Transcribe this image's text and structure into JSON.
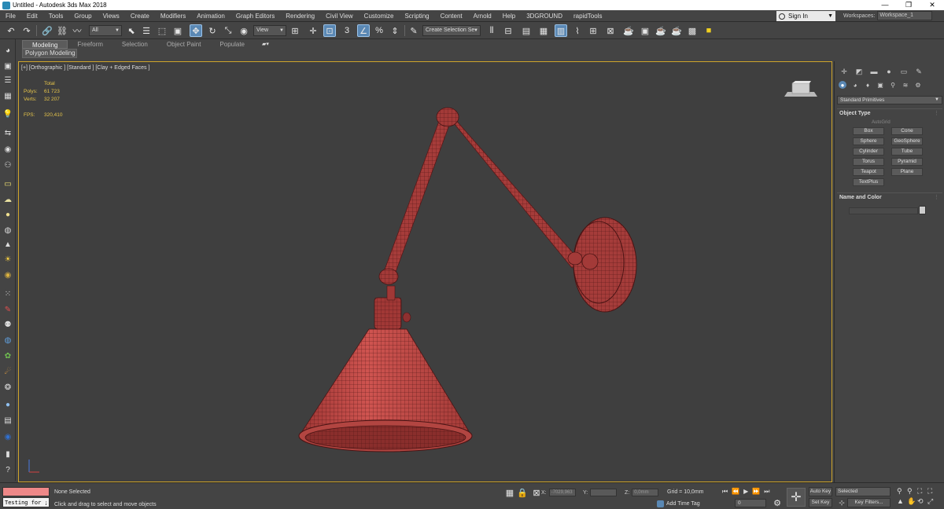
{
  "window": {
    "title": "Untitled - Autodesk 3ds Max 2018",
    "minimize": "—",
    "maximize": "❐",
    "close": "✕"
  },
  "menu": [
    "File",
    "Edit",
    "Tools",
    "Group",
    "Views",
    "Create",
    "Modifiers",
    "Animation",
    "Graph Editors",
    "Rendering",
    "Civil View",
    "Customize",
    "Scripting",
    "Content",
    "Arnold",
    "Help",
    "3DGROUND",
    "rapidTools"
  ],
  "account": {
    "signin": "Sign In",
    "workspaces_label": "Workspaces:",
    "workspace": "Workspace_1"
  },
  "toolbar": {
    "filter": "All",
    "refcoord": "View",
    "selection_set": "Create Selection Se"
  },
  "ribbon": {
    "tabs": [
      "Modeling",
      "Freeform",
      "Selection",
      "Object Paint",
      "Populate"
    ],
    "panel": "Polygon Modeling"
  },
  "viewport": {
    "label": "[+] [Orthographic ] [Standard ] [Clay + Edged Faces ]",
    "stats": {
      "total": "Total",
      "polys_label": "Polys:",
      "polys": "61 723",
      "verts_label": "Verts:",
      "verts": "32 207",
      "fps_label": "FPS:",
      "fps": "320,410"
    },
    "colors": {
      "border": "#cfa52a",
      "mesh": "#b84440",
      "wire": "#4a1414",
      "stats_text": "#e6c44a"
    }
  },
  "command_panel": {
    "category": "Standard Primitives",
    "object_type_title": "Object Type",
    "autogrid": "AutoGrid",
    "buttons": [
      "Box",
      "Cone",
      "Sphere",
      "GeoSphere",
      "Cylinder",
      "Tube",
      "Torus",
      "Pyramid",
      "Teapot",
      "Plane",
      "TextPlus"
    ],
    "name_color_title": "Name and Color"
  },
  "status": {
    "script_input": "Testing for ;",
    "selection": "None Selected",
    "prompt": "Click and drag to select and move objects",
    "x_label": "X:",
    "x": "-7029,963",
    "y_label": "Y:",
    "y": "",
    "z_label": "Z:",
    "z": "0,0mm",
    "grid": "Grid = 10,0mm",
    "add_time_tag": "Add Time Tag",
    "frame": "0",
    "auto_key": "Auto Key",
    "set_key": "Set Key",
    "selected": "Selected",
    "key_filters": "Key Filters..."
  }
}
